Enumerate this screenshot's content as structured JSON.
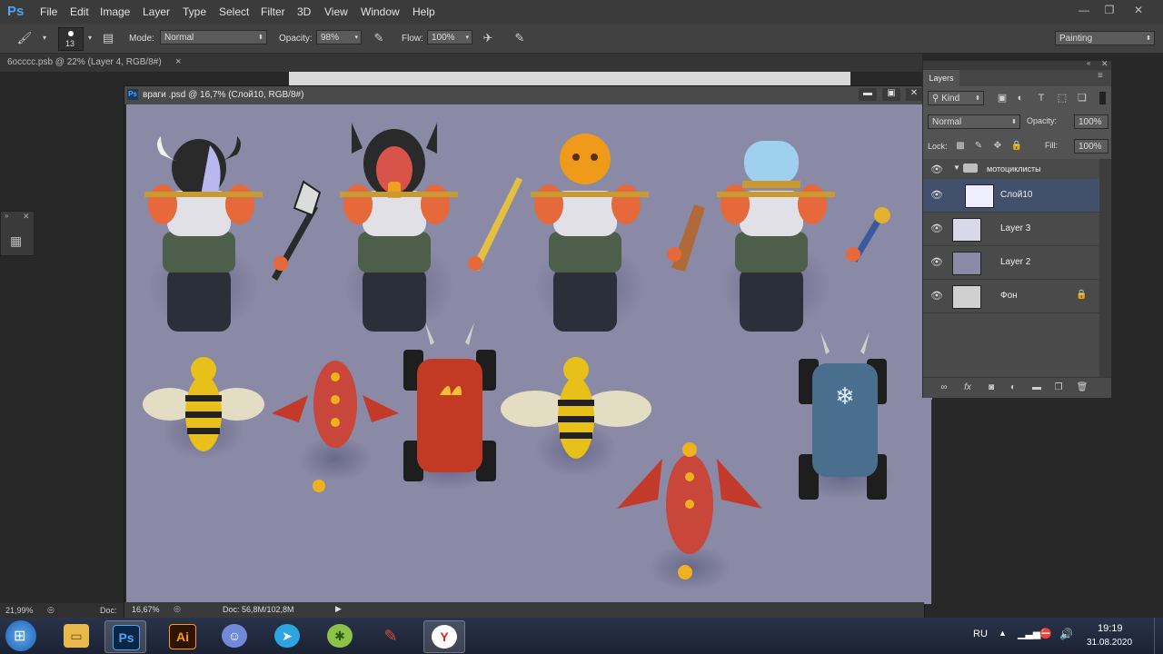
{
  "app": {
    "logo": "Ps"
  },
  "menu": [
    "File",
    "Edit",
    "Image",
    "Layer",
    "Type",
    "Select",
    "Filter",
    "3D",
    "View",
    "Window",
    "Help"
  ],
  "window_controls": {
    "minimize": "—",
    "restore": "❐",
    "close": "✕"
  },
  "options_bar": {
    "brush_size": "13",
    "mode_label": "Mode:",
    "mode_value": "Normal",
    "opacity_label": "Opacity:",
    "opacity_value": "98%",
    "flow_label": "Flow:",
    "flow_value": "100%",
    "workspace": "Painting"
  },
  "doc_tabs": {
    "background_doc": "6occcc.psb @ 22% (Layer 4, RGB/8#)",
    "close": "×"
  },
  "document": {
    "title": "враги .psd @ 16,7% (Слой10, RGB/8#)",
    "zoom": "16,67%",
    "doc_info": "Doc: 56,8M/102,8M"
  },
  "background_status": {
    "zoom": "21,99%",
    "doc_label": "Doc:"
  },
  "layers_panel": {
    "title": "Layers",
    "filter_kind": "Kind",
    "blend_mode": "Normal",
    "opacity_label": "Opacity:",
    "opacity_value": "100%",
    "lock_label": "Lock:",
    "fill_label": "Fill:",
    "fill_value": "100%",
    "group_name": "мотоциклисты",
    "layers": [
      {
        "name": "Слой10",
        "selected": true
      },
      {
        "name": "Layer 3",
        "selected": false
      },
      {
        "name": "Layer 2",
        "selected": false
      },
      {
        "name": "Фон",
        "selected": false,
        "locked": true
      }
    ],
    "footer_fx": "fx"
  },
  "taskbar": {
    "apps": [
      "start",
      "explorer",
      "photoshop",
      "illustrator",
      "discord",
      "telegram",
      "lime",
      "pencil",
      "yandex"
    ],
    "ps_label": "Ps",
    "ai_label": "Ai",
    "yandex_label": "Y",
    "language": "RU",
    "time": "19:19",
    "date": "31.08.2020"
  },
  "colors": {
    "accent": "#4ea4f2",
    "canvas_bg": "#8a8aa6",
    "selected_layer": "#41506b"
  }
}
